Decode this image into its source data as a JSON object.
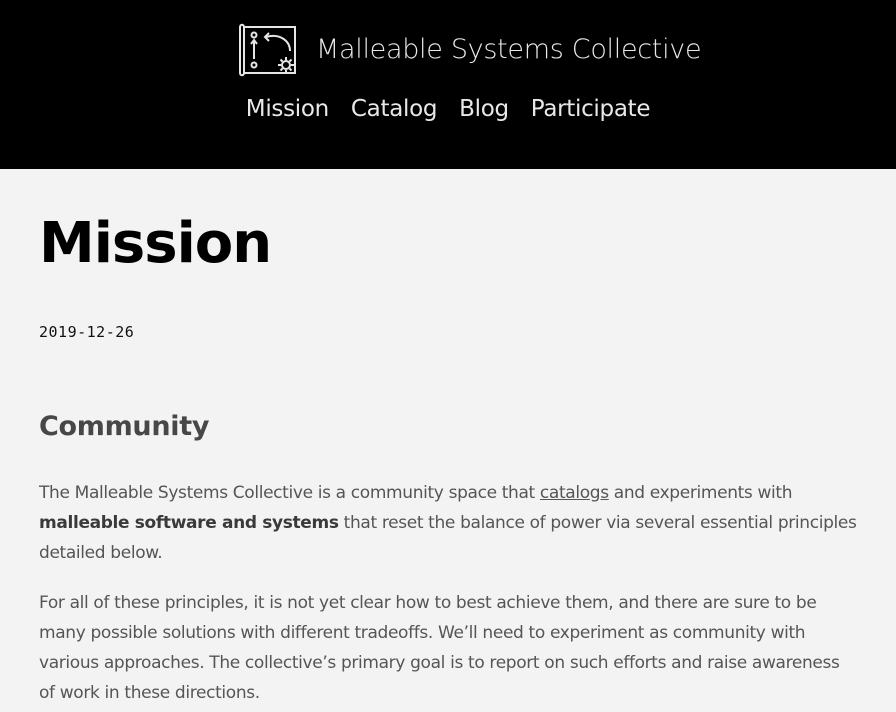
{
  "site": {
    "name": "Malleable Systems Collective",
    "logo_icon": "blueprint-gear-icon"
  },
  "nav": {
    "items": [
      {
        "label": "Mission"
      },
      {
        "label": "Catalog"
      },
      {
        "label": "Blog"
      },
      {
        "label": "Participate"
      }
    ]
  },
  "post": {
    "title": "Mission",
    "date": "2019-12-26",
    "section_heading": "Community",
    "paragraph1": {
      "text_before_link": "The Malleable Systems Collective is a community space that ",
      "link_text": "catalogs",
      "text_after_link": " and experiments with ",
      "bold_text": "malleable software and systems",
      "text_end": " that reset the balance of power via several essential principles detailed below."
    },
    "paragraph2": "For all of these principles, it is not yet clear how to best achieve them, and there are sure to be many possible solutions with different tradeoffs. We’ll need to experiment as community with various approaches. The collective’s primary goal is to report on such efforts and raise awareness of work in these directions."
  },
  "colors": {
    "header_bg": "#000000",
    "page_bg": "#f3f3f3",
    "body_text": "#555555",
    "heading_text": "#474747"
  }
}
